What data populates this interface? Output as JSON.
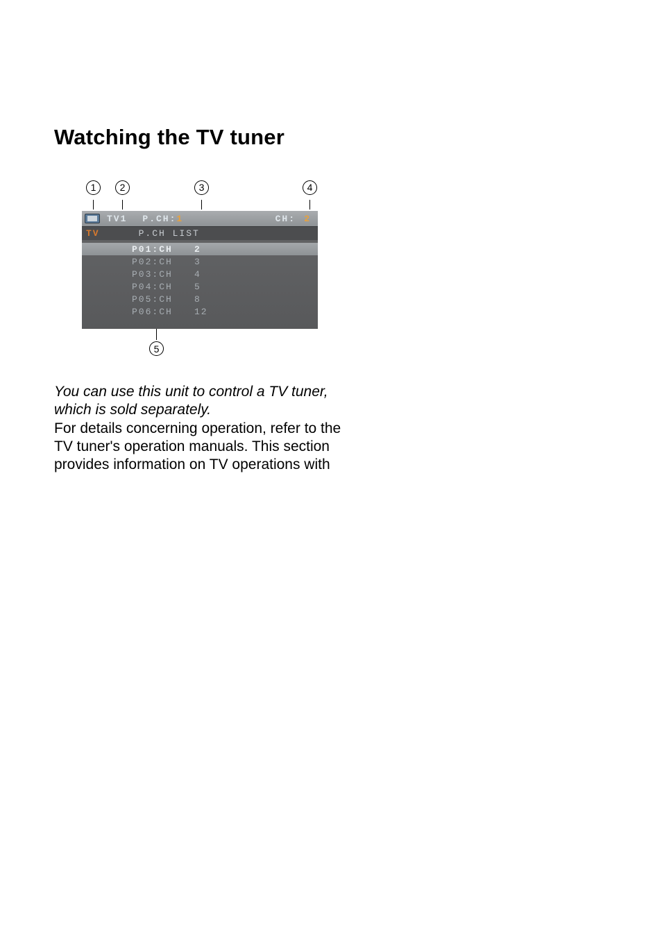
{
  "heading": "Watching the TV tuner",
  "callouts": {
    "c1": "1",
    "c2": "2",
    "c3": "3",
    "c4": "4",
    "c5": "5"
  },
  "tv_header": {
    "source": "TV1",
    "pch_label": "P.CH:",
    "pch_value": "1",
    "ch_label": "CH:",
    "ch_value": "2"
  },
  "tv_subheader": {
    "tv_label": "TV",
    "list_label": "P.CH LIST"
  },
  "presets": [
    {
      "label": "P01:CH",
      "value": "2",
      "highlight": true
    },
    {
      "label": "P02:CH",
      "value": "3",
      "highlight": false
    },
    {
      "label": "P03:CH",
      "value": "4",
      "highlight": false
    },
    {
      "label": "P04:CH",
      "value": "5",
      "highlight": false
    },
    {
      "label": "P05:CH",
      "value": "8",
      "highlight": false
    },
    {
      "label": "P06:CH",
      "value": "12",
      "highlight": false
    }
  ],
  "body": {
    "p1": "You can use this unit to control a TV tuner, which is sold separately.",
    "p2": "For details concerning operation, refer to the TV tuner's operation manuals. This section provides information on TV operations with"
  }
}
